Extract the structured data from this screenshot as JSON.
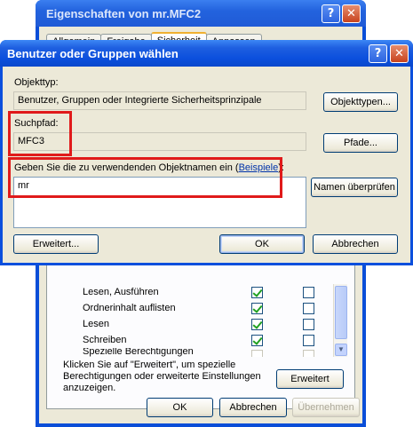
{
  "background_window": {
    "title": "Eigenschaften von mr.MFC2",
    "tabs": [
      "Allgemein",
      "Freigabe",
      "Sicherheit",
      "Anpassen"
    ],
    "permissions": [
      {
        "name": "Lesen, Ausführen",
        "allow": true,
        "deny": false
      },
      {
        "name": "Ordnerinhalt auflisten",
        "allow": true,
        "deny": false
      },
      {
        "name": "Lesen",
        "allow": true,
        "deny": false
      },
      {
        "name": "Schreiben",
        "allow": true,
        "deny": false
      },
      {
        "name": "Spezielle Berechtigungen",
        "allow": false,
        "deny": false
      }
    ],
    "advanced_text": "Klicken Sie auf \"Erweitert\", um spezielle Berechtigungen oder erweiterte Einstellungen anzuzeigen.",
    "advanced_button": "Erweitert",
    "ok_button": "OK",
    "cancel_button": "Abbrechen",
    "apply_button": "Übernehmen"
  },
  "dialog": {
    "title": "Benutzer oder Gruppen wählen",
    "object_type_label": "Objekttyp:",
    "object_type_value": "Benutzer, Gruppen oder Integrierte Sicherheitsprinzipale",
    "object_types_button": "Objekttypen...",
    "search_path_label": "Suchpfad:",
    "search_path_value": "MFC3",
    "paths_button": "Pfade...",
    "enter_names_label": "Geben Sie die zu verwendenden Objektnamen ein (",
    "examples_link": "Beispiele",
    "enter_names_suffix": "):",
    "names_value": "mr",
    "check_names_button": "Namen überprüfen",
    "advanced_button": "Erweitert...",
    "ok_button": "OK",
    "cancel_button": "Abbrechen"
  },
  "colors": {
    "highlight": "#e01a1a",
    "titlebar": "#0b4fdd",
    "dialog_bg": "#ece9d8"
  }
}
